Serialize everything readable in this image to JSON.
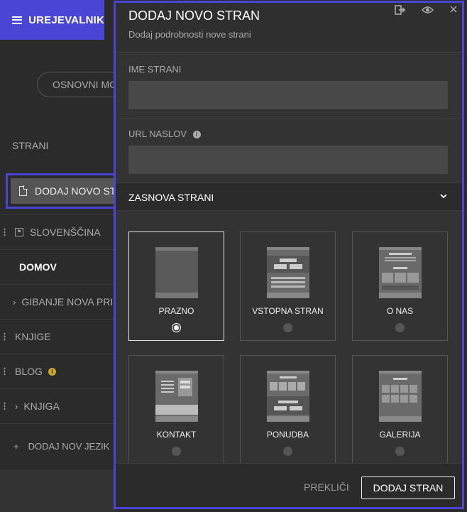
{
  "app": {
    "title": "UREJEVALNIK"
  },
  "sidebar": {
    "mode_button": "OSNOVNI MODE",
    "pages_label": "STRANI",
    "add_page": "DODAJ NOVO STRAN",
    "items": [
      {
        "label": "SLOVENŠČINA"
      },
      {
        "label": "DOMOV"
      },
      {
        "label": "GIBANJE NOVA PRIHODNOST"
      },
      {
        "label": "KNJIGE"
      },
      {
        "label": "BLOG"
      },
      {
        "label": "KNJIGA"
      }
    ],
    "add_language": "DODAJ NOV JEZIK"
  },
  "modal": {
    "title": "DODAJ NOVO STRAN",
    "subtitle": "Dodaj podrobnosti nove strani",
    "name_label": "IME STRANI",
    "name_value": "",
    "url_label": "URL NASLOV",
    "url_value": "",
    "layout_section": "ZASNOVA STRANI",
    "templates": [
      {
        "label": "PRAZNO",
        "selected": true
      },
      {
        "label": "VSTOPNA STRAN",
        "selected": false
      },
      {
        "label": "O NAS",
        "selected": false
      },
      {
        "label": "KONTAKT",
        "selected": false
      },
      {
        "label": "PONUDBA",
        "selected": false
      },
      {
        "label": "GALERIJA",
        "selected": false
      }
    ],
    "cancel": "PREKLIČI",
    "submit": "DODAJ STRAN"
  },
  "colors": {
    "accent": "#4b45d6",
    "warning": "#c9a52c"
  }
}
